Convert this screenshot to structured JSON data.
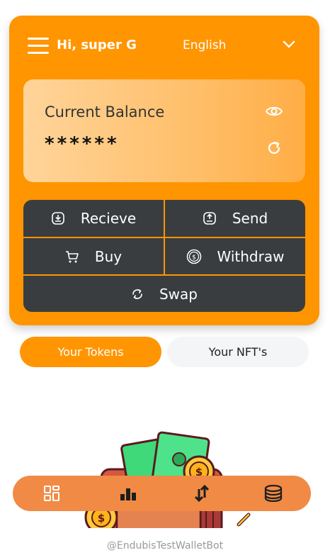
{
  "header": {
    "greeting": "Hi, super G",
    "language": "English"
  },
  "balance": {
    "title": "Current Balance",
    "masked_value": "******"
  },
  "actions": {
    "receive": "Recieve",
    "send": "Send",
    "buy": "Buy",
    "withdraw": "Withdraw",
    "swap": "Swap"
  },
  "tabs": {
    "tokens": "Your Tokens",
    "nfts": "Your NFT's",
    "active": "tokens"
  },
  "bottom_nav": {
    "items": [
      "dashboard-icon",
      "chart-icon",
      "transfer-icon",
      "coins-icon"
    ]
  },
  "footer": {
    "handle": "@EndubisTestWalletBot"
  },
  "colors": {
    "accent": "#ff9500",
    "dark": "#3a3d40",
    "nav": "#f08a45"
  }
}
